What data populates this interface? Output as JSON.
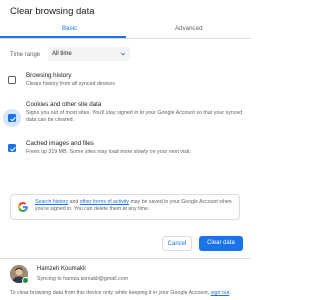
{
  "dialog": {
    "title": "Clear browsing data"
  },
  "tabs": [
    {
      "label": "Basic",
      "selected": true
    },
    {
      "label": "Advanced",
      "selected": false
    }
  ],
  "time_range": {
    "label": "Time range",
    "value": "All time"
  },
  "options": [
    {
      "title": "Browsing history",
      "desc": "Clears history from all synced devices",
      "checked": false
    },
    {
      "title": "Cookies and other site data",
      "desc": "Signs you out of most sites. You'll stay signed in to your Google Account so that your synced data can be cleared.",
      "checked": true
    },
    {
      "title": "Cached images and files",
      "desc": "Frees up 319 MB. Some sites may load more slowly on your next visit.",
      "checked": true
    }
  ],
  "info": {
    "link1": "Search history",
    "text1": " and ",
    "link2": "other forms of activity",
    "text2": " may be saved in your Google Account when you're signed in. You can delete them at any time."
  },
  "buttons": {
    "cancel": "Cancel",
    "clear": "Clear data"
  },
  "account": {
    "name": "Hamzeh Koumakli",
    "sync": "Syncing to hamza.komakli@gmail.com"
  },
  "footer": {
    "text": "To clear browsing data from this device only, while keeping it in your Google Account, ",
    "link": "sign out",
    "end": "."
  },
  "colors": {
    "accent": "#1a73e8",
    "text": "#202124",
    "secondary": "#5f6368",
    "sync_badge": "#1e8e3e"
  }
}
